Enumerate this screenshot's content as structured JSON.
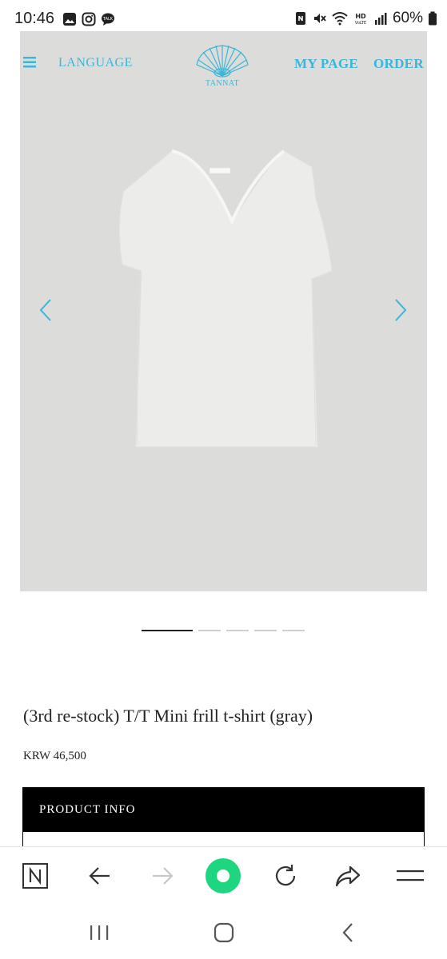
{
  "status_bar": {
    "time": "10:46",
    "battery": "60%",
    "left_icons": [
      "gallery-icon",
      "instagram-icon",
      "talk-icon"
    ],
    "right_icons": [
      "nfc-icon",
      "mute-icon",
      "wifi-icon",
      "hd-voice-icon",
      "signal-icon",
      "battery-icon"
    ]
  },
  "site_nav": {
    "language": "LANGUAGE",
    "my_page": "MY PAGE",
    "order": "ORDER",
    "logo_text": "TANNAT"
  },
  "carousel": {
    "slide_count": 5,
    "active_index": 0
  },
  "product": {
    "title": "(3rd re-stock) T/T Mini frill t-shirt (gray)",
    "price": "KRW 46,500",
    "info_tab": "PRODUCT INFO"
  },
  "colors": {
    "accent": "#3bb6d8",
    "hero_bg": "#dcdcda",
    "tab_bg": "#000000",
    "reload_green": "#1ed67f"
  },
  "browser_toolbar": {
    "buttons": [
      "naver-icon",
      "back-icon",
      "forward-icon",
      "green-dot-icon",
      "reload-icon",
      "share-icon",
      "menu-icon"
    ]
  },
  "system_nav": {
    "buttons": [
      "recents-icon",
      "home-icon",
      "back-icon"
    ]
  }
}
